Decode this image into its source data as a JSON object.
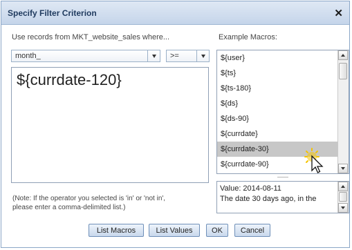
{
  "dialog": {
    "title": "Specify Filter Criterion"
  },
  "left": {
    "prompt": "Use records from MKT_website_sales where...",
    "field_value": "month_",
    "operator_value": ">=",
    "editor_text": "${currdate-120}",
    "note_line1": "(Note: If the operator you selected is 'in' or 'not in',",
    "note_line2": "please enter a comma-delimited list.)"
  },
  "right": {
    "label": "Example Macros:",
    "macros": [
      "${user}",
      "${ts}",
      "${ts-180}",
      "${ds}",
      "${ds-90}",
      "${currdate}",
      "${currdate-30}",
      "${currdate-90}"
    ],
    "selected_index": 6,
    "desc_line1": "Value: 2014-08-11",
    "desc_line2": "The date 30 days ago, in the"
  },
  "buttons": {
    "list_macros": "List Macros",
    "list_values": "List Values",
    "ok": "OK",
    "cancel": "Cancel"
  },
  "icons": {
    "close": "close-icon",
    "cursor": "mouse-cursor-icon"
  },
  "colors": {
    "title_bar": "#c5d5ea",
    "selection": "#c7c7c7",
    "button": "#c8d8ec",
    "highlight": "#f5c400"
  }
}
